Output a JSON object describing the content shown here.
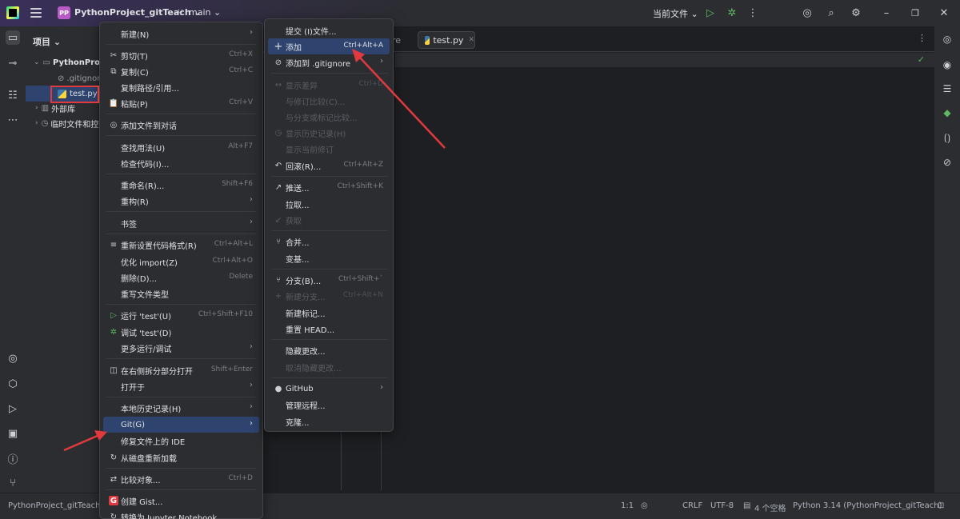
{
  "titlebar": {
    "project_badge": "PP",
    "project_name": "PythonProject_gitTeach ⌄",
    "branch": "main ⌄",
    "run_config": "当前文件 ⌄"
  },
  "project_panel": {
    "title": "项目 ⌄",
    "tree": [
      {
        "label": "PythonProj",
        "type": "folder"
      },
      {
        "label": ".gitignore",
        "type": "file"
      },
      {
        "label": "test.py",
        "type": "python"
      },
      {
        "label": "外部库",
        "type": "folder"
      },
      {
        "label": "临时文件和控",
        "type": "folder"
      }
    ]
  },
  "editor": {
    "tab_partial": "re",
    "tab_label": "test.py"
  },
  "context_menu": {
    "items": [
      {
        "label": "新建(N)",
        "shortcut": "",
        "submenu": true,
        "icon": "",
        "disabled": false
      },
      {
        "label": "剪切(T)",
        "shortcut": "Ctrl+X",
        "icon": "✂"
      },
      {
        "label": "复制(C)",
        "shortcut": "Ctrl+C",
        "icon": "⧉"
      },
      {
        "label": "复制路径/引用...",
        "shortcut": "",
        "icon": ""
      },
      {
        "label": "粘贴(P)",
        "shortcut": "Ctrl+V",
        "icon": "📋"
      },
      {
        "label": "添加文件到对话",
        "shortcut": "",
        "icon": "◎"
      },
      {
        "label": "查找用法(U)",
        "shortcut": "Alt+F7",
        "icon": ""
      },
      {
        "label": "检查代码(I)...",
        "shortcut": "",
        "icon": ""
      },
      {
        "label": "重命名(R)...",
        "shortcut": "Shift+F6",
        "icon": ""
      },
      {
        "label": "重构(R)",
        "shortcut": "",
        "submenu": true,
        "icon": ""
      },
      {
        "label": "书签",
        "shortcut": "",
        "submenu": true,
        "icon": ""
      },
      {
        "label": "重新设置代码格式(R)",
        "shortcut": "Ctrl+Alt+L",
        "icon": "≡"
      },
      {
        "label": "优化 import(Z)",
        "shortcut": "Ctrl+Alt+O",
        "icon": ""
      },
      {
        "label": "删除(D)...",
        "shortcut": "Delete",
        "icon": ""
      },
      {
        "label": "重写文件类型",
        "shortcut": "",
        "icon": ""
      },
      {
        "label": "运行 'test'(U)",
        "shortcut": "Ctrl+Shift+F10",
        "icon": "▷"
      },
      {
        "label": "调试 'test'(D)",
        "shortcut": "",
        "icon": "✲"
      },
      {
        "label": "更多运行/调试",
        "shortcut": "",
        "submenu": true,
        "icon": ""
      },
      {
        "label": "在右侧拆分部分打开",
        "shortcut": "Shift+Enter",
        "icon": "◫"
      },
      {
        "label": "打开于",
        "shortcut": "",
        "submenu": true,
        "icon": ""
      },
      {
        "label": "本地历史记录(H)",
        "shortcut": "",
        "submenu": true,
        "icon": ""
      },
      {
        "label": "Git(G)",
        "shortcut": "",
        "submenu": true,
        "icon": ""
      },
      {
        "label": "修复文件上的 IDE",
        "shortcut": "",
        "icon": ""
      },
      {
        "label": "从磁盘重新加载",
        "shortcut": "",
        "icon": "↻"
      },
      {
        "label": "比较对象...",
        "shortcut": "Ctrl+D",
        "icon": "⇄"
      },
      {
        "label": "创建 Gist...",
        "shortcut": "",
        "icon": "G"
      },
      {
        "label": "转换为 Jupyter Notebook",
        "shortcut": "",
        "icon": "↻"
      }
    ]
  },
  "git_submenu": {
    "items": [
      {
        "label": "提交 (I)文件...",
        "shortcut": "",
        "icon": ""
      },
      {
        "label": "添加",
        "shortcut": "Ctrl+Alt+A",
        "icon": "+"
      },
      {
        "label": "添加到 .gitignore",
        "shortcut": "",
        "submenu": true,
        "icon": "⊘"
      },
      {
        "label": "显示差异",
        "shortcut": "Ctrl+D",
        "icon": "↔",
        "disabled": true
      },
      {
        "label": "与修订比较(C)...",
        "shortcut": "",
        "icon": "",
        "disabled": true
      },
      {
        "label": "与分支或标记比较...",
        "shortcut": "",
        "icon": "",
        "disabled": true
      },
      {
        "label": "显示历史记录(H)",
        "shortcut": "",
        "icon": "◷",
        "disabled": true
      },
      {
        "label": "显示当前修订",
        "shortcut": "",
        "icon": "",
        "disabled": true
      },
      {
        "label": "回滚(R)...",
        "shortcut": "Ctrl+Alt+Z",
        "icon": "↶"
      },
      {
        "label": "推送...",
        "shortcut": "Ctrl+Shift+K",
        "icon": "↗"
      },
      {
        "label": "拉取...",
        "shortcut": "",
        "icon": ""
      },
      {
        "label": "获取",
        "shortcut": "",
        "icon": "↙",
        "disabled": true
      },
      {
        "label": "合并...",
        "shortcut": "",
        "icon": "⑂"
      },
      {
        "label": "变基...",
        "shortcut": "",
        "icon": ""
      },
      {
        "label": "分支(B)...",
        "shortcut": "Ctrl+Shift+`",
        "icon": "⑂"
      },
      {
        "label": "新建分支...",
        "shortcut": "Ctrl+Alt+N",
        "icon": "+",
        "disabled": true
      },
      {
        "label": "新建标记...",
        "shortcut": "",
        "icon": ""
      },
      {
        "label": "重置 HEAD...",
        "shortcut": "",
        "icon": ""
      },
      {
        "label": "隐藏更改...",
        "shortcut": "",
        "icon": ""
      },
      {
        "label": "取消隐藏更改...",
        "shortcut": "",
        "icon": "",
        "disabled": true
      },
      {
        "label": "GitHub",
        "shortcut": "",
        "submenu": true,
        "icon": "●"
      },
      {
        "label": "管理远程...",
        "shortcut": "",
        "icon": ""
      },
      {
        "label": "克隆...",
        "shortcut": "",
        "icon": ""
      }
    ]
  },
  "statusbar": {
    "project": "PythonProject_gitTeach",
    "position": "1:1",
    "line_ending": "CRLF",
    "encoding": "UTF-8",
    "indent": "4 个空格",
    "interpreter": "Python 3.14 (PythonProject_gitTeach)"
  },
  "colors": {
    "background": "#1e1f22",
    "panel": "#2b2d30",
    "highlight": "#2e436e",
    "annotation_red": "#e0393e"
  }
}
